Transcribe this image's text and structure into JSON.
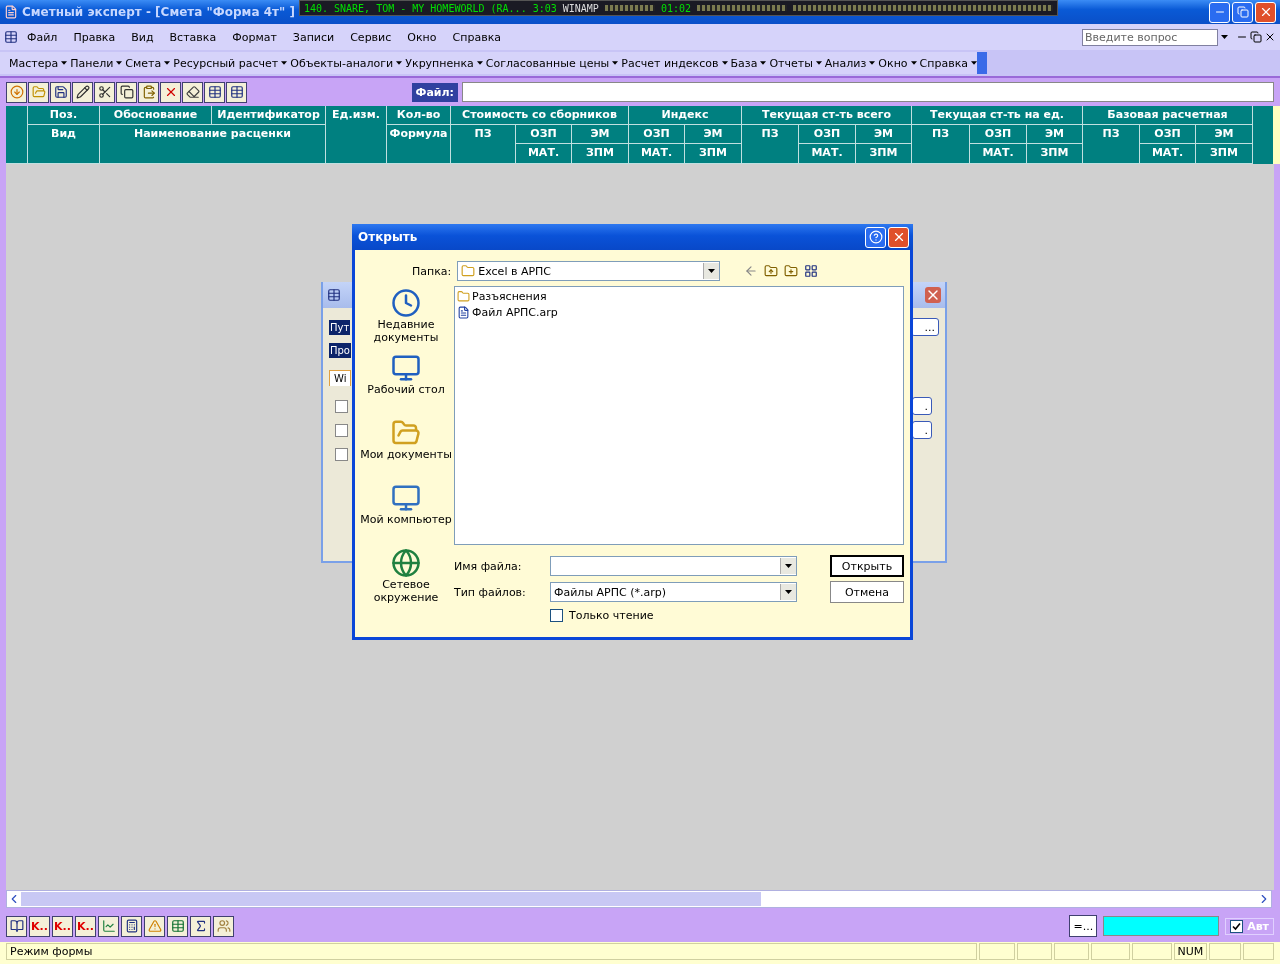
{
  "window": {
    "title": "Сметный эксперт - [Смета \"Форма 4т\" ]"
  },
  "winamp": {
    "track": "140. SNARE, TOM - MY HOMEWORLD (RA...",
    "time": "3:03",
    "brand": "WINAMP",
    "elapsed": "01:02"
  },
  "menu": [
    "Файл",
    "Правка",
    "Вид",
    "Вставка",
    "Формат",
    "Записи",
    "Сервис",
    "Окно",
    "Справка"
  ],
  "help_search": {
    "placeholder": "Введите вопрос"
  },
  "menu2": [
    "Мастера",
    "Панели",
    "Смета",
    "Ресурсный расчет",
    "Объекты-аналоги",
    "Укрупненка",
    "Согласованные цены",
    "Расчет индексов",
    "База",
    "Отчеты",
    "Анализ",
    "Окно",
    "Справка"
  ],
  "file_field": {
    "label": "Файл:"
  },
  "table": {
    "header_row_1": [
      "Поз.",
      "Обоснование",
      "Идентификатор",
      "Ед.изм.",
      "Кол-во",
      "Стоимость со сборников",
      "Индекс",
      "Текущая ст-ть всего",
      "Текущая ст-ть на ед.",
      "Базовая расчетная"
    ],
    "header_row_2": [
      "Вид",
      "Наименование расценки",
      "Формула",
      "ПЗ",
      "ОЗП",
      "ЭМ",
      "ОЗП",
      "ЭМ",
      "ПЗ",
      "ОЗП",
      "ЭМ",
      "ПЗ",
      "ОЗП",
      "ЭМ",
      "ПЗ",
      "ОЗП",
      "ЭМ"
    ],
    "header_row_3": [
      "МАТ.",
      "ЗПМ",
      "МАТ.",
      "ЗПМ",
      "МАТ.",
      "ЗПМ",
      "МАТ.",
      "ЗПМ",
      "МАТ.",
      "ЗПМ"
    ]
  },
  "back_dialog": {
    "labels": [
      "Пут",
      "Про"
    ],
    "tab": "Wi",
    "checkboxes": [
      {
        "checked": false
      },
      {
        "checked": false
      },
      {
        "checked": false
      }
    ],
    "buttons": [
      "...",
      ".",
      "."
    ]
  },
  "dialog": {
    "title": "Открыть",
    "folder_label": "Папка:",
    "folder": "Excel в АРПС",
    "places": [
      {
        "kind": "recent",
        "label": "Недавние документы"
      },
      {
        "kind": "desktop",
        "label": "Рабочий стол"
      },
      {
        "kind": "documents",
        "label": "Мои документы"
      },
      {
        "kind": "computer",
        "label": "Мой компьютер"
      },
      {
        "kind": "network",
        "label": "Сетевое окружение"
      }
    ],
    "files": [
      {
        "kind": "folder",
        "name": "Разъяснения"
      },
      {
        "kind": "file",
        "name": "Файл АРПС.arp"
      }
    ],
    "filename_label": "Имя файла:",
    "filetype_label": "Тип файлов:",
    "filetype": "Файлы АРПС (*.arp)",
    "readonly": {
      "label": "Только чтение",
      "checked": false
    },
    "buttons": [
      "Открыть",
      "Отмена"
    ]
  },
  "bottom_toolbar": {
    "k_buttons": [
      "K..",
      "K..",
      "K.."
    ],
    "formula_button": "=...",
    "auto": {
      "label": "Авт",
      "checked": true
    }
  },
  "status_bar": {
    "mode": "Режим формы",
    "num": "NUM"
  }
}
